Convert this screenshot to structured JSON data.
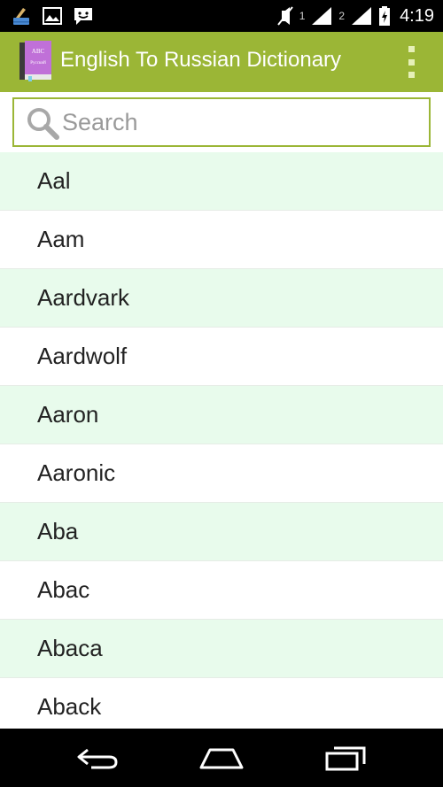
{
  "status_bar": {
    "sim1_label": "1",
    "sim2_label": "2",
    "time": "4:19",
    "left_icons": [
      "broom-icon",
      "image-icon",
      "messenger-icon"
    ],
    "right_icons": [
      "mute-icon",
      "signal-icon",
      "battery-icon"
    ]
  },
  "app_bar": {
    "title": "English To Russian Dictionary",
    "icon_text_top": "ABC",
    "icon_text_bottom": "Русский",
    "accent_color": "#9bb636"
  },
  "search": {
    "placeholder": "Search",
    "value": ""
  },
  "list": {
    "rows": [
      {
        "word": "Aal"
      },
      {
        "word": "Aam"
      },
      {
        "word": "Aardvark"
      },
      {
        "word": "Aardwolf"
      },
      {
        "word": "Aaron"
      },
      {
        "word": "Aaronic"
      },
      {
        "word": "Aba"
      },
      {
        "word": "Abac"
      },
      {
        "word": "Abaca"
      },
      {
        "word": "Aback"
      }
    ],
    "alt_row_color": "#e8fbec"
  },
  "nav_bar": {
    "buttons": [
      "back-icon",
      "home-icon",
      "recents-icon"
    ]
  }
}
